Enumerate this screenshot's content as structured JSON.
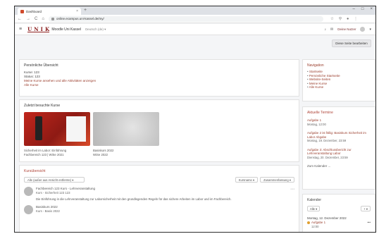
{
  "browser": {
    "tab_title": "Dashboard",
    "tab_close": "×",
    "new_tab": "+",
    "url": "online.ecampus.uni-kassel.de/my/",
    "window_controls": [
      "–",
      "□",
      "×"
    ],
    "nav": {
      "back": "←",
      "forward": "→",
      "reload": "C",
      "home": "⌂"
    }
  },
  "header": {
    "menu_glyph": "≡",
    "logo": "U N I K",
    "site_name": "Moodle Uni Kassel",
    "language": "Deutsch (de) ▾",
    "bell": "♪",
    "chat": "✉",
    "user_name": "Deine Nutzer",
    "user_chevron": "▾"
  },
  "main": {
    "customise_button": "Diese Seite bearbeiten",
    "timeline": {
      "title": "Persönliche Übersicht",
      "lines": [
        "Kurse: 123",
        "Status: 123"
      ],
      "link_lines": [
        "Meine Kurse ansehen und alle Aktivitäten anzeigen",
        "Alle Kurse"
      ]
    },
    "recent": {
      "title": "Zuletzt besuchte Kurse",
      "items": [
        {
          "name": "Sicherheit im Labor: Einführung",
          "meta": "Fachbereich 123 | WiSe 2021"
        },
        {
          "name": "Basiskurs 2022",
          "meta": "WiSe 2022"
        }
      ]
    },
    "courses": {
      "title": "Kursübersicht",
      "filter": "Alle (außer aus Ansicht entfernte) ▾",
      "sort": "Kursname ▾",
      "view": "Zusammenfassung ▾",
      "items": [
        {
          "name": "Fachbereich 123 Kurs - Lehrveranstaltung",
          "sub": "Kurs - Sicherheit 123 123",
          "desc": "Die Einführung in die Lehrveranstaltung zur Laborsicherheit mit den grundlegenden Regeln für das sichere Arbeiten im Labor und im Fachbereich."
        },
        {
          "name": "Basiskurs 2022",
          "sub": "Kurs - Basis 2022",
          "desc": ""
        }
      ]
    }
  },
  "sidebar": {
    "navigation": {
      "title": "Navigation",
      "items": [
        "Startseite",
        "Persönliche Startseite",
        "Website-Seiten",
        "Meine Kurse",
        "Alle Kurse"
      ]
    },
    "upcoming": {
      "title": "Aktuelle Termine",
      "events": [
        {
          "title": "Aufgabe 1",
          "date": "Montag, 12:00"
        },
        {
          "title": "Aufgabe 2 ist fällig: Basiskurs Sicherheit im Labor Abgabe",
          "date": "Montag, 19. Dezember, 23:59"
        },
        {
          "title": "Aufgabe 3: Abschlussbericht zur Lehrveranstaltung Labor",
          "date": "Dienstag, 20. Dezember, 23:59"
        }
      ],
      "more": "Zum Kalender ..."
    },
    "calendar": {
      "title": "Kalender",
      "select": "Alle ▾",
      "new_event": "+ ▾",
      "day": "Montag, 12. Dezember 2022",
      "event": "Aufgabe 1",
      "event_time": "12:00",
      "more_glyph": "•••"
    }
  }
}
